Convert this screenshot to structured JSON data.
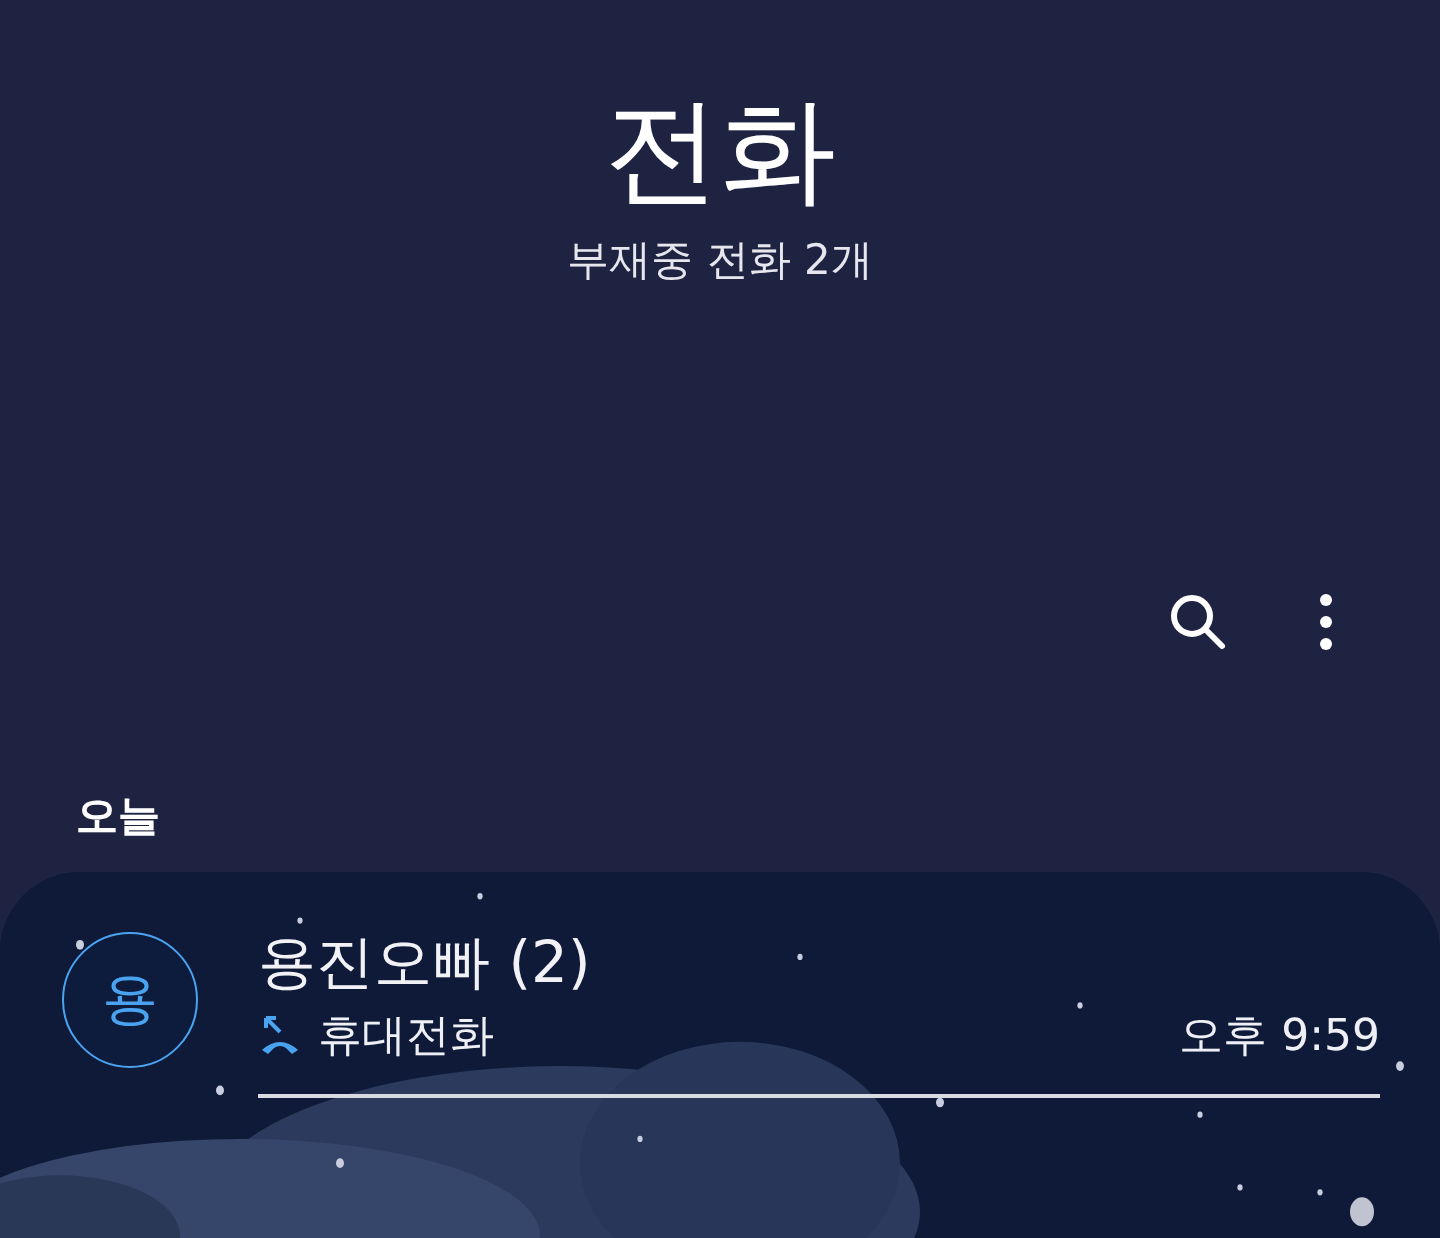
{
  "header": {
    "title": "전화",
    "subtitle": "부재중 전화 2개"
  },
  "section": {
    "label": "오늘"
  },
  "calls": [
    {
      "avatar": "용",
      "name": "용진오빠 (2)",
      "type": "휴대전화",
      "time": "오후 9:59",
      "missed": true
    }
  ]
}
